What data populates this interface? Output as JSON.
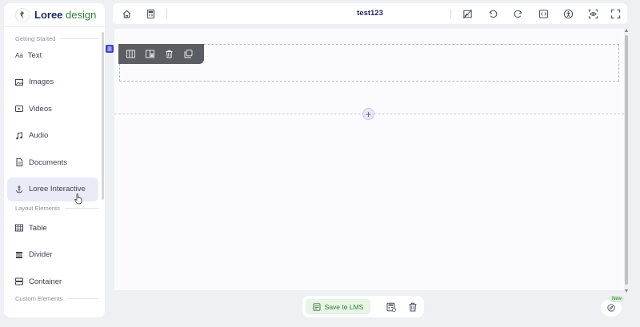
{
  "app": {
    "logo_text": "Loree",
    "logo_text_suffix": "design"
  },
  "sidebar": {
    "sections": [
      {
        "label": "Getting Started"
      },
      {
        "label": "Layout Elements"
      },
      {
        "label": "Custom Elements"
      }
    ],
    "items": [
      {
        "label": "Text",
        "icon": "text-icon",
        "icon_glyph": "Aa"
      },
      {
        "label": "Images",
        "icon": "image-icon"
      },
      {
        "label": "Videos",
        "icon": "video-icon"
      },
      {
        "label": "Audio",
        "icon": "music-note-icon"
      },
      {
        "label": "Documents",
        "icon": "document-icon"
      },
      {
        "label": "Loree Interactive",
        "icon": "anchor-icon",
        "active": true
      },
      {
        "label": "Table",
        "icon": "table-icon"
      },
      {
        "label": "Divider",
        "icon": "divider-icon"
      },
      {
        "label": "Container",
        "icon": "container-icon"
      }
    ]
  },
  "topbar": {
    "title": "test123",
    "left_icons": [
      "home-icon",
      "template-icon"
    ],
    "right_icons": [
      "hide-image-icon",
      "undo-icon",
      "redo-icon",
      "code-icon",
      "accessibility-icon",
      "preview-icon",
      "fullscreen-icon"
    ]
  },
  "canvas": {
    "block_toolbar_icons": [
      "columns-icon",
      "column-layout-icon",
      "delete-icon",
      "copy-icon"
    ],
    "add_row_symbol": "+"
  },
  "bottombar": {
    "save_label": "Save to LMS",
    "icons": [
      "save-template-icon",
      "trash-icon"
    ]
  },
  "help": {
    "badge": "New"
  },
  "colors": {
    "brand_dark": "#1a2a5a",
    "brand_green": "#2b7e3a",
    "accent_blue": "#3a47c4"
  }
}
